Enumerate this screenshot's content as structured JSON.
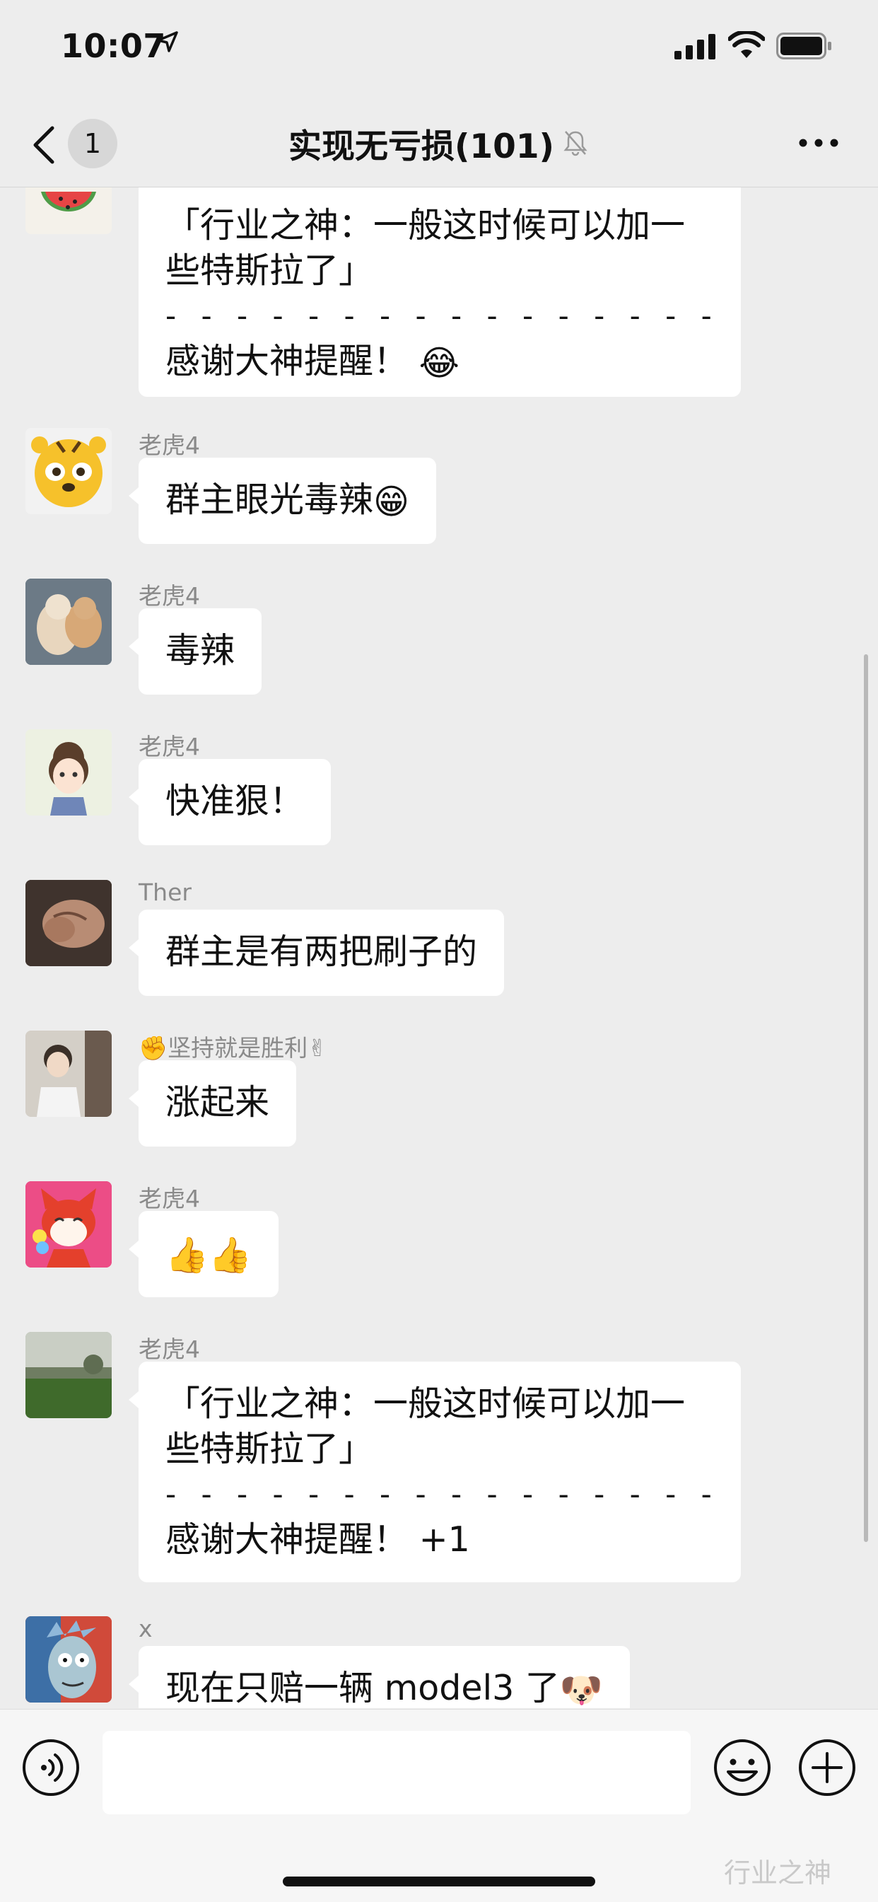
{
  "status_bar": {
    "time": "10:07"
  },
  "nav": {
    "unread_count": "1",
    "title": "实现无亏损(101)"
  },
  "messages": [
    {
      "sender": "",
      "lines": [
        "「行业之神：一般这时候可以加一",
        "些特斯拉了」",
        "- - - - - - - - - - - - - - - -",
        "感谢大神提醒！"
      ],
      "emoji": "😂"
    },
    {
      "sender": "老虎4",
      "lines": [
        "群主眼光毒辣"
      ],
      "emoji": "😁"
    },
    {
      "sender": "老虎4",
      "lines": [
        "毒辣"
      ]
    },
    {
      "sender": "老虎4",
      "lines": [
        "快准狠！"
      ]
    },
    {
      "sender": "Ther",
      "lines": [
        "群主是有两把刷子的"
      ]
    },
    {
      "sender": "✊坚持就是胜利✌",
      "lines": [
        "涨起来"
      ]
    },
    {
      "sender": "老虎4",
      "lines": [
        ""
      ],
      "emoji": "👍👍"
    },
    {
      "sender": "老虎4",
      "lines": [
        "「行业之神：一般这时候可以加一",
        "些特斯拉了」",
        "- - - - - - - - - - - - - - - -",
        "感谢大神提醒！ +1"
      ]
    },
    {
      "sender": "x",
      "lines": [
        "现在只赔一辆 model3 了"
      ],
      "emoji": "🐶"
    }
  ],
  "input": {
    "value": "",
    "placeholder": ""
  },
  "watermark": "行业之神"
}
